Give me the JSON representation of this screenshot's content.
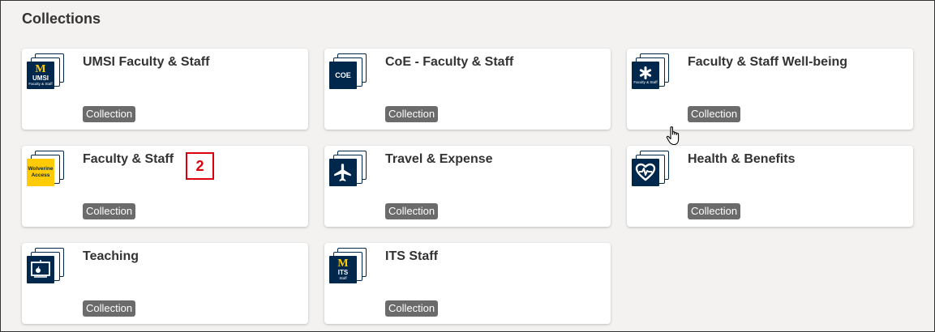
{
  "section": {
    "heading": "Collections"
  },
  "cards": [
    {
      "title": "UMSI Faculty & Staff",
      "badge": "Collection",
      "icon": {
        "name": "umsi-logo-icon",
        "lines": [
          "M",
          "UMSI",
          "Faculty & Staff"
        ]
      }
    },
    {
      "title": "CoE - Faculty & Staff",
      "badge": "Collection",
      "icon": {
        "name": "coe-logo-icon",
        "lines": [
          "COE"
        ]
      }
    },
    {
      "title": "Faculty & Staff Well-being",
      "badge": "Collection",
      "icon": {
        "name": "wellbeing-logo-icon",
        "lines": [
          "Faculty & Staff"
        ]
      }
    },
    {
      "title": "Faculty & Staff",
      "badge": "Collection",
      "icon": {
        "name": "wolverine-access-logo-icon",
        "lines": [
          "Wolverine",
          "Access"
        ]
      }
    },
    {
      "title": "Travel & Expense",
      "badge": "Collection",
      "icon": {
        "name": "airplane-icon"
      }
    },
    {
      "title": "Health & Benefits",
      "badge": "Collection",
      "icon": {
        "name": "heart-pulse-icon"
      }
    },
    {
      "title": "Teaching",
      "badge": "Collection",
      "icon": {
        "name": "chalkboard-apple-icon"
      }
    },
    {
      "title": "ITS Staff",
      "badge": "Collection",
      "icon": {
        "name": "its-logo-icon",
        "lines": [
          "M",
          "ITS",
          "Staff"
        ]
      }
    }
  ],
  "annotation": {
    "step_number": "2",
    "color": "#d9000d"
  },
  "colors": {
    "navy": "#00274c",
    "maize": "#ffcb05",
    "badge": "#6b6b6b",
    "background": "#f3f2f1"
  }
}
